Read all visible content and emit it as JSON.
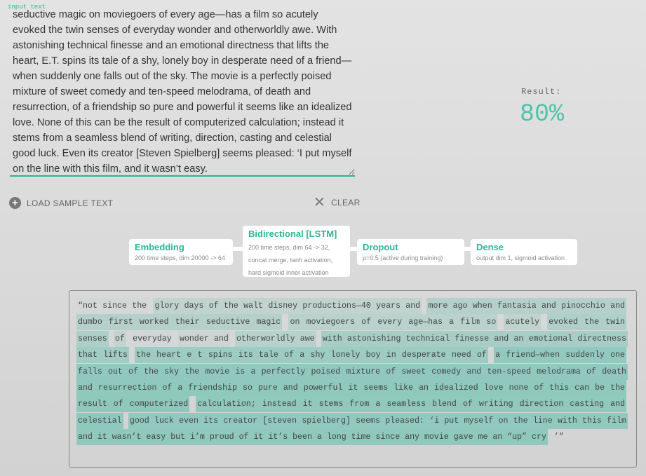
{
  "input": {
    "label": "input text",
    "value": "seductive magic on moviegoers of every age—has a film so acutely evoked the twin senses of everyday wonder and otherworldly awe. With astonishing technical finesse and an emotional directness that lifts the heart, E.T. spins its tale of a shy, lonely boy in desperate need of a friend—when suddenly one falls out of the sky. The movie is a perfectly poised mixture of sweet comedy and ten-speed melodrama, of death and resurrection, of a friendship so pure and powerful it seems like an idealized love. None of this can be the result of computerized calculation; instead it stems from a seamless blend of writing, direction, casting and celestial good luck. Even its creator [Steven Spielberg] seems pleased: ‘I put myself on the line with this film, and it wasn’t easy."
  },
  "result": {
    "label": "Result:",
    "value": "80%"
  },
  "buttons": {
    "load": "LOAD SAMPLE TEXT",
    "clear": "CLEAR"
  },
  "layers": [
    {
      "title": "Embedding",
      "desc": [
        "200 time steps, dim 20000 -> 64"
      ]
    },
    {
      "title": "Bidirectional [LSTM]",
      "desc": [
        "200 time steps, dim 64 -> 32,",
        "concat merge, tanh activation,",
        "hard sigmoid inner activation"
      ]
    },
    {
      "title": "Dropout",
      "desc": [
        "p=0.5 (active during training)"
      ]
    },
    {
      "title": "Dense",
      "desc": [
        "output dim 1, sigmoid activation"
      ]
    }
  ],
  "colors": {
    "accent": "#2bb594",
    "highlight": "#6cc2b0"
  },
  "tokens": [
    {
      "text": "“not since the",
      "a": 0.05
    },
    {
      "text": "glory days of the walt disney productions—40 years and",
      "a": 0.22
    },
    {
      "text": "more ago when fantasia and pinocchio and dumbo first worked their seductive magic",
      "a": 0.32
    },
    {
      "text": "on moviegoers of every age—has a film so",
      "a": 0.28
    },
    {
      "text": "acutely",
      "a": 0.22
    },
    {
      "text": "evoked the twin senses",
      "a": 0.38
    },
    {
      "text": "of",
      "a": 0.2
    },
    {
      "text": "everyday",
      "a": 0.03
    },
    {
      "text": "wonder and",
      "a": 0.1
    },
    {
      "text": "otherworldly awe",
      "a": 0.3
    },
    {
      "text": "with astonishing technical finesse and an emotional directness",
      "a": 0.45
    },
    {
      "text": "that lifts",
      "a": 0.5
    },
    {
      "text": "the heart e t spins its tale of a shy lonely boy in desperate need of",
      "a": 0.55
    },
    {
      "text": "a friend—when suddenly one falls out of the sky the movie is a perfectly poised mixture of sweet comedy and ten-speed melodrama of death",
      "a": 0.65
    },
    {
      "text": "and resurrection of a friendship so pure and powerful it seems like an idealized love none of this can be the result of computerized",
      "a": 0.68
    },
    {
      "text": "calculation; instead it stems from a seamless blend of writing direction casting and celestial",
      "a": 0.66
    },
    {
      "text": "good luck even its creator [steven spielberg] seems pleased: ‘i put myself on the line with this film",
      "a": 0.64
    },
    {
      "text": "and it wasn’t easy but i’m proud of it it’s been a long time since any movie gave me an “up” cry",
      "a": 0.66
    },
    {
      "text": "’”",
      "a": 0
    }
  ]
}
